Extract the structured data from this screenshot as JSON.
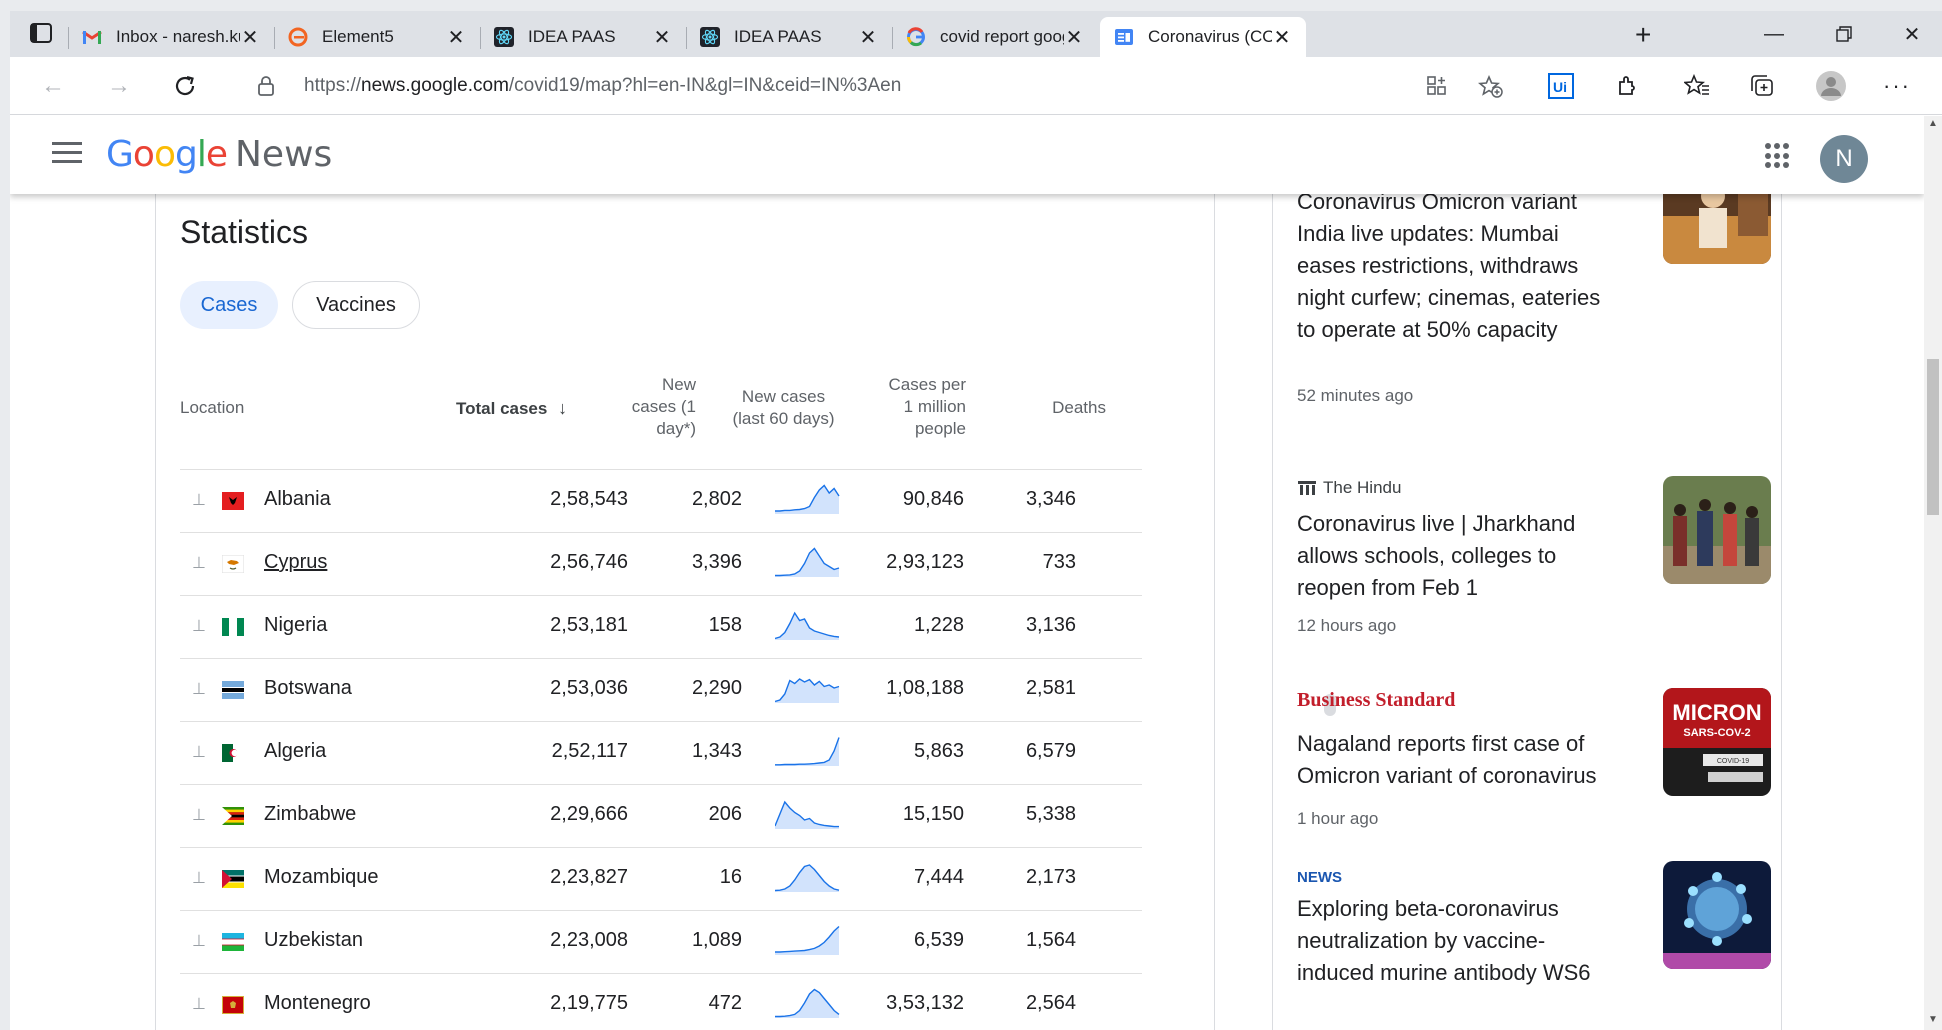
{
  "browser": {
    "tabs": [
      {
        "title": "Inbox - naresh.kuma",
        "icon": "gmail-icon"
      },
      {
        "title": "Element5",
        "icon": "element5-icon"
      },
      {
        "title": "IDEA PAAS",
        "icon": "react-icon"
      },
      {
        "title": "IDEA PAAS",
        "icon": "react-icon"
      },
      {
        "title": "covid report google",
        "icon": "google-icon"
      },
      {
        "title": "Coronavirus (COVID",
        "icon": "google-news-icon"
      }
    ],
    "address": {
      "prefix": "https://",
      "host": "news.google.com",
      "path": "/covid19/map?hl=en-IN&gl=IN&ceid=IN%3Aen"
    }
  },
  "header": {
    "logo_google": [
      "G",
      "o",
      "o",
      "g",
      "l",
      "e"
    ],
    "logo_colors": [
      "#4285F4",
      "#EA4335",
      "#FBBC05",
      "#4285F4",
      "#34A853",
      "#EA4335"
    ],
    "logo_news": "News",
    "avatar_letter": "N"
  },
  "stats": {
    "title": "Statistics",
    "tabs": {
      "cases": "Cases",
      "vaccines": "Vaccines"
    },
    "columns": {
      "location": "Location",
      "total_cases": "Total cases",
      "new_cases": [
        "New",
        "cases (1",
        "day*)"
      ],
      "new_cases_60": [
        "New cases",
        "(last 60 days)"
      ],
      "cases_per_million": [
        "Cases per",
        "1 million",
        "people"
      ],
      "deaths": "Deaths"
    },
    "rows": [
      {
        "country": "Albania",
        "total": "2,58,543",
        "new": "2,802",
        "per_million": "90,846",
        "deaths": "3,346",
        "trend": [
          0.1,
          0.1,
          0.12,
          0.12,
          0.14,
          0.15,
          0.18,
          0.25,
          0.55,
          0.8,
          0.95,
          0.7,
          0.85,
          0.6
        ]
      },
      {
        "country": "Cyprus",
        "total": "2,56,746",
        "new": "3,396",
        "per_million": "2,93,123",
        "deaths": "733",
        "trend": [
          0.05,
          0.05,
          0.06,
          0.07,
          0.1,
          0.2,
          0.45,
          0.8,
          0.95,
          0.7,
          0.45,
          0.35,
          0.25,
          0.3
        ]
      },
      {
        "country": "Nigeria",
        "total": "2,53,181",
        "new": "158",
        "per_million": "1,228",
        "deaths": "3,136",
        "trend": [
          0.05,
          0.1,
          0.25,
          0.55,
          0.9,
          0.65,
          0.7,
          0.4,
          0.3,
          0.25,
          0.2,
          0.15,
          0.12,
          0.1
        ]
      },
      {
        "country": "Botswana",
        "total": "2,53,036",
        "new": "2,290",
        "per_million": "1,08,188",
        "deaths": "2,581",
        "trend": [
          0.05,
          0.1,
          0.3,
          0.75,
          0.65,
          0.8,
          0.7,
          0.78,
          0.6,
          0.72,
          0.55,
          0.6,
          0.5,
          0.55
        ]
      },
      {
        "country": "Algeria",
        "total": "2,52,117",
        "new": "1,343",
        "per_million": "5,863",
        "deaths": "6,579",
        "trend": [
          0.04,
          0.04,
          0.05,
          0.05,
          0.05,
          0.06,
          0.06,
          0.07,
          0.08,
          0.1,
          0.12,
          0.2,
          0.5,
          0.95
        ]
      },
      {
        "country": "Zimbabwe",
        "total": "2,29,666",
        "new": "206",
        "per_million": "15,150",
        "deaths": "5,338",
        "trend": [
          0.1,
          0.5,
          0.9,
          0.7,
          0.55,
          0.45,
          0.3,
          0.35,
          0.2,
          0.15,
          0.12,
          0.1,
          0.08,
          0.08
        ]
      },
      {
        "country": "Mozambique",
        "total": "2,23,827",
        "new": "16",
        "per_million": "7,444",
        "deaths": "2,173",
        "trend": [
          0.05,
          0.06,
          0.1,
          0.2,
          0.4,
          0.65,
          0.85,
          0.9,
          0.75,
          0.55,
          0.35,
          0.2,
          0.1,
          0.06
        ]
      },
      {
        "country": "Uzbekistan",
        "total": "2,23,008",
        "new": "1,089",
        "per_million": "6,539",
        "deaths": "1,564",
        "trend": [
          0.1,
          0.1,
          0.11,
          0.12,
          0.13,
          0.14,
          0.15,
          0.18,
          0.22,
          0.3,
          0.42,
          0.6,
          0.8,
          0.95
        ]
      },
      {
        "country": "Montenegro",
        "total": "2,19,775",
        "new": "472",
        "per_million": "3,53,132",
        "deaths": "2,564",
        "trend": [
          0.05,
          0.05,
          0.06,
          0.08,
          0.12,
          0.25,
          0.5,
          0.8,
          0.95,
          0.85,
          0.65,
          0.45,
          0.25,
          0.12
        ]
      }
    ],
    "colors": {
      "spark_line": "#1a73e8",
      "spark_fill": "#d2e3fc"
    }
  },
  "news": [
    {
      "source": "",
      "headline_lines": [
        "Coronavirus Omicron variant",
        "India live updates: Mumbai",
        "eases restrictions, withdraws",
        "night curfew; cinemas, eateries",
        "to operate at 50% capacity"
      ],
      "time": "52 minutes ago"
    },
    {
      "source": "The Hindu",
      "headline_lines": [
        "Coronavirus live | Jharkhand",
        "allows schools, colleges to",
        "reopen from Feb 1"
      ],
      "time": "12 hours ago"
    },
    {
      "source": "Business Standard",
      "headline_lines": [
        "Nagaland reports first case of",
        "Omicron variant of coronavirus"
      ],
      "time": "1 hour ago"
    },
    {
      "source": "NEWS",
      "headline_lines": [
        "Exploring beta-coronavirus",
        "neutralization by vaccine-",
        "induced murine antibody WS6"
      ],
      "time": ""
    }
  ],
  "thumb_text": {
    "micron": "MICRON",
    "sars": "SARS-COV-2",
    "covid": "COVID-19"
  }
}
